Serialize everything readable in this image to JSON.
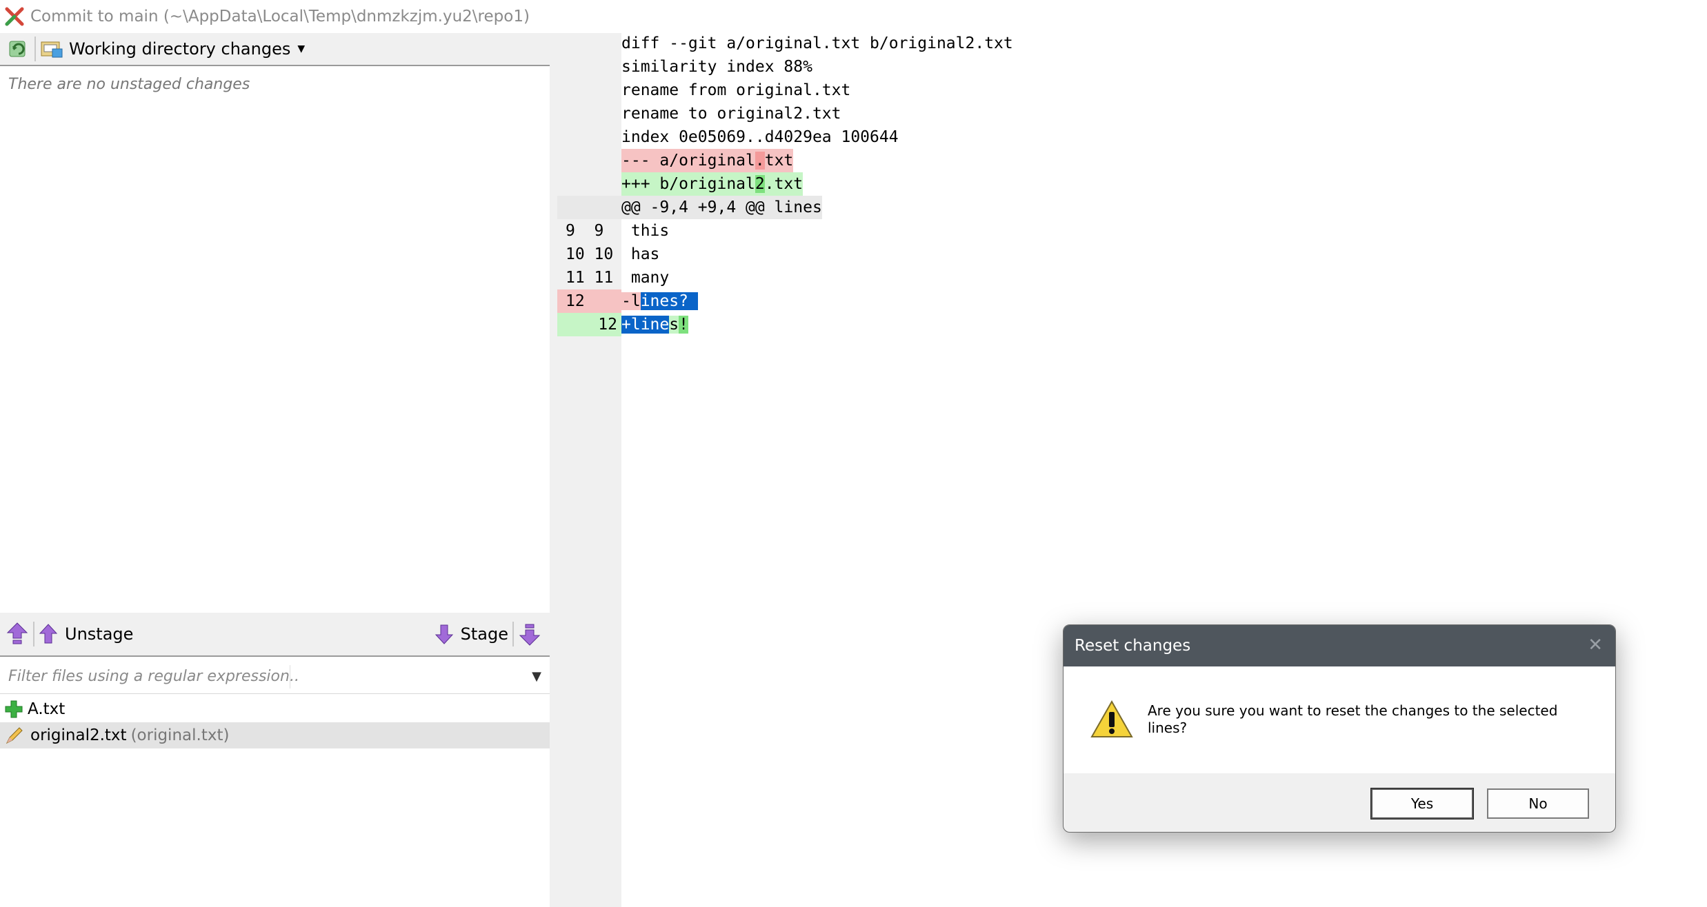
{
  "window": {
    "title": "Commit to main (~\\AppData\\Local\\Temp\\dnmzkzjm.yu2\\repo1)"
  },
  "unstaged": {
    "toolbar": {
      "workdir_label": "Working directory changes"
    },
    "empty_message": "There are no unstaged changes"
  },
  "staging": {
    "unstage_label": "Unstage",
    "stage_label": "Stage"
  },
  "filter": {
    "placeholder": "Filter files using a regular expression..."
  },
  "staged_files": [
    {
      "name": "A.txt",
      "status": "added"
    },
    {
      "name": "original2.txt",
      "original": "(original.txt)",
      "status": "renamed"
    }
  ],
  "diff": {
    "header": [
      "diff --git a/original.txt b/original2.txt",
      "similarity index 88%",
      "rename from original.txt",
      "rename to original2.txt",
      "index 0e05069..d4029ea 100644"
    ],
    "minus_file": {
      "pre": "--- a/original",
      "hl": ".",
      "post": "txt"
    },
    "plus_file": {
      "pre": "+++ b/original",
      "hl": "2",
      "post": ".txt"
    },
    "hunk": "@@ -9,4 +9,4 @@ lines",
    "context": [
      {
        "old": "9  9",
        "text": " this"
      },
      {
        "old": "10 10",
        "text": " has"
      },
      {
        "old": "11 11",
        "text": " many"
      }
    ],
    "removed": {
      "old": "12",
      "a": "-l",
      "b": "ines?",
      "c": " "
    },
    "added": {
      "new": "12",
      "a": "+line",
      "b": "s",
      "c": "!"
    }
  },
  "dialog": {
    "title": "Reset changes",
    "message": "Are you sure you want to reset the changes to the selected lines?",
    "yes_label": "Yes",
    "no_label": "No"
  }
}
